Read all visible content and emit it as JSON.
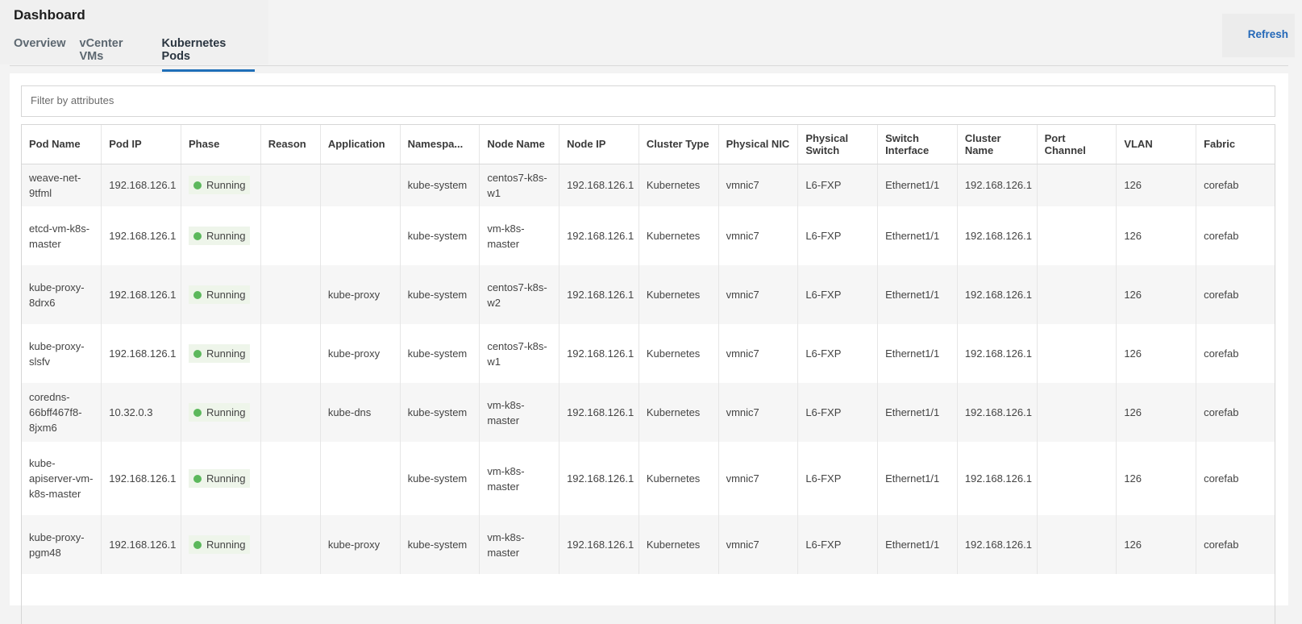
{
  "header": {
    "title": "Dashboard",
    "tabs": [
      {
        "label": "Overview",
        "active": false
      },
      {
        "label": "vCenter VMs",
        "active": false
      },
      {
        "label": "Kubernetes Pods",
        "active": true
      }
    ],
    "refresh_label": "Refresh"
  },
  "filter": {
    "placeholder": "Filter by attributes"
  },
  "colors": {
    "accent": "#1f6fb8",
    "link": "#2468b8",
    "running": "#5cb85c"
  },
  "table": {
    "columns": [
      "Pod Name",
      "Pod IP",
      "Phase",
      "Reason",
      "Application",
      "Namespa...",
      "Node Name",
      "Node IP",
      "Cluster Type",
      "Physical NIC",
      "Physical Switch",
      "Switch Interface",
      "Cluster Name",
      "Port Channel",
      "VLAN",
      "Fabric"
    ],
    "rows": [
      [
        "weave-net-9tfml",
        "192.168.126.1",
        "Running",
        "",
        "",
        "kube-system",
        "centos7-k8s-w1",
        "192.168.126.1",
        "Kubernetes",
        "vmnic7",
        "L6-FXP",
        "Ethernet1/1",
        "192.168.126.1",
        "",
        "126",
        "corefab"
      ],
      [
        "etcd-vm-k8s-master",
        "192.168.126.1",
        "Running",
        "",
        "",
        "kube-system",
        "vm-k8s-master",
        "192.168.126.1",
        "Kubernetes",
        "vmnic7",
        "L6-FXP",
        "Ethernet1/1",
        "192.168.126.1",
        "",
        "126",
        "corefab"
      ],
      [
        "kube-proxy-8drx6",
        "192.168.126.1",
        "Running",
        "",
        "kube-proxy",
        "kube-system",
        "centos7-k8s-w2",
        "192.168.126.1",
        "Kubernetes",
        "vmnic7",
        "L6-FXP",
        "Ethernet1/1",
        "192.168.126.1",
        "",
        "126",
        "corefab"
      ],
      [
        "kube-proxy-slsfv",
        "192.168.126.1",
        "Running",
        "",
        "kube-proxy",
        "kube-system",
        "centos7-k8s-w1",
        "192.168.126.1",
        "Kubernetes",
        "vmnic7",
        "L6-FXP",
        "Ethernet1/1",
        "192.168.126.1",
        "",
        "126",
        "corefab"
      ],
      [
        "coredns-66bff467f8-8jxm6",
        "10.32.0.3",
        "Running",
        "",
        "kube-dns",
        "kube-system",
        "vm-k8s-master",
        "192.168.126.1",
        "Kubernetes",
        "vmnic7",
        "L6-FXP",
        "Ethernet1/1",
        "192.168.126.1",
        "",
        "126",
        "corefab"
      ],
      [
        "kube-apiserver-vm-k8s-master",
        "192.168.126.1",
        "Running",
        "",
        "",
        "kube-system",
        "vm-k8s-master",
        "192.168.126.1",
        "Kubernetes",
        "vmnic7",
        "L6-FXP",
        "Ethernet1/1",
        "192.168.126.1",
        "",
        "126",
        "corefab"
      ],
      [
        "kube-proxy-pgm48",
        "192.168.126.1",
        "Running",
        "",
        "kube-proxy",
        "kube-system",
        "vm-k8s-master",
        "192.168.126.1",
        "Kubernetes",
        "vmnic7",
        "L6-FXP",
        "Ethernet1/1",
        "192.168.126.1",
        "",
        "126",
        "corefab"
      ]
    ]
  }
}
